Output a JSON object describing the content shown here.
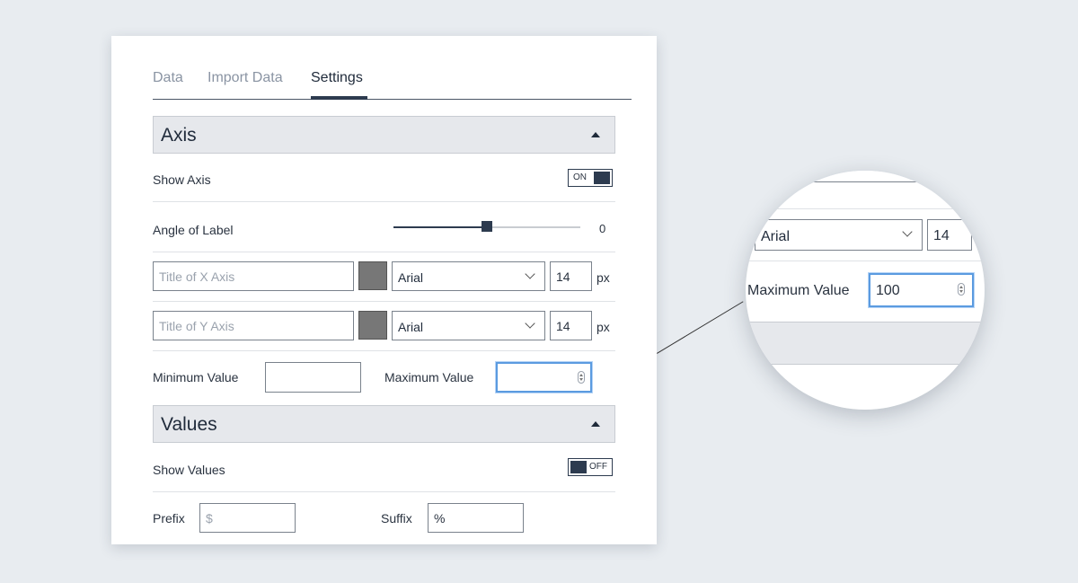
{
  "tabs": [
    {
      "label": "Data",
      "active": false
    },
    {
      "label": "Import Data",
      "active": false
    },
    {
      "label": "Settings",
      "active": true
    }
  ],
  "axis_section": {
    "title": "Axis",
    "show_axis": {
      "label": "Show Axis",
      "state": "ON"
    },
    "angle_of_label": {
      "label": "Angle of Label",
      "value": "0",
      "slider_fraction": 0.5
    },
    "x_axis": {
      "title_placeholder": "Title of X Axis",
      "color": "#777777",
      "font": "Arial",
      "size": "14",
      "unit": "px"
    },
    "y_axis": {
      "title_placeholder": "Title of Y Axis",
      "color": "#777777",
      "font": "Arial",
      "size": "14",
      "unit": "px"
    },
    "min_value": {
      "label": "Minimum Value",
      "value": ""
    },
    "max_value": {
      "label": "Maximum Value",
      "value": ""
    }
  },
  "values_section": {
    "title": "Values",
    "show_values": {
      "label": "Show Values",
      "state": "OFF"
    },
    "prefix": {
      "label": "Prefix",
      "placeholder": "$"
    },
    "suffix": {
      "label": "Suffix",
      "value": "%"
    }
  },
  "zoom": {
    "font": "Arial",
    "size": "14",
    "max_value_label": "Maximum Value",
    "max_value": "100"
  },
  "colors": {
    "accent": "#2d3b4f",
    "focus": "#5b9be0",
    "page_bg": "#e8ecf0"
  }
}
